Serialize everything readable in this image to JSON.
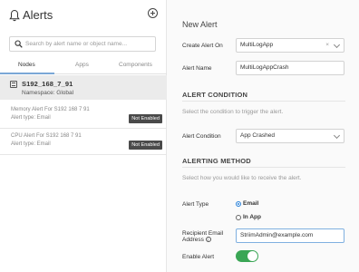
{
  "sidebar": {
    "title": "Alerts",
    "search_placeholder": "Search by alert name or object name...",
    "tabs": [
      {
        "label": "Nodes",
        "active": true
      },
      {
        "label": "Apps",
        "active": false
      },
      {
        "label": "Components",
        "active": false
      }
    ],
    "node": {
      "name": "S192_168_7_91",
      "namespace": "Namespace: Global"
    },
    "alerts": [
      {
        "name": "Memory Alert For S192 168 7 91",
        "type": "Alert type: Email",
        "status": "Not Enabled"
      },
      {
        "name": "CPU Alert For S192 168 7 91",
        "type": "Alert type: Email",
        "status": "Not Enabled"
      }
    ]
  },
  "form": {
    "title": "New Alert",
    "create_on_label": "Create Alert On",
    "create_on_value": "MultiLogApp",
    "clear_symbol": "×",
    "alert_name_label": "Alert Name",
    "alert_name_value": "MultiLogAppCrash",
    "condition_section_title": "ALERT CONDITION",
    "condition_section_sub": "Select the condition to trigger the alert.",
    "condition_label": "Alert Condition",
    "condition_value": "App Crashed",
    "method_section_title": "ALERTING METHOD",
    "method_section_sub": "Select how you would like to receive the alert.",
    "alert_type_label": "Alert Type",
    "alert_type_options": [
      {
        "label": "Email",
        "selected": true
      },
      {
        "label": "In App",
        "selected": false
      }
    ],
    "recipient_label_line1": "Recipient Email",
    "recipient_label_line2": "Address",
    "info_symbol": "i",
    "recipient_value": "StriimAdmin@example.com",
    "enable_label": "Enable Alert",
    "enable_on": true
  },
  "colors": {
    "accent": "#2b82d9",
    "toggle_on": "#3aa655",
    "badge_bg": "#4a4a4a"
  }
}
